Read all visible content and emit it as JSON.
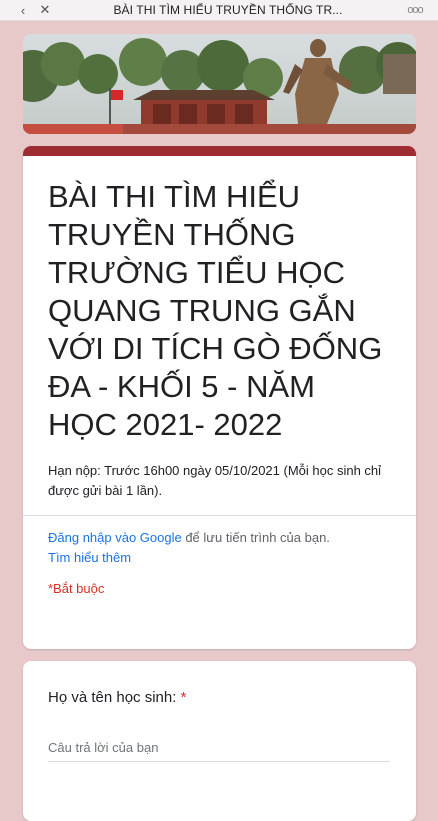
{
  "topbar": {
    "back_icon": "‹",
    "close_icon": "✕",
    "title": "BÀI THI TÌM HIỂU TRUYỀN THỐNG TR...",
    "more_icon": "ooo"
  },
  "form": {
    "title": "BÀI THI TÌM HIỂU TRUYỀN THỐNG TRƯỜNG TIỂU HỌC QUANG TRUNG GẮN VỚI DI TÍCH GÒ ĐỐNG ĐA - KHỐI 5 - NĂM HỌC 2021- 2022",
    "description": "Hạn nộp: Trước 16h00 ngày 05/10/2021 (Mỗi học sinh chỉ được gửi bài 1 lần).",
    "login_link": "Đăng nhập vào Google",
    "login_suffix": " để lưu tiến trình của bạn.",
    "learn_more": "Tìm hiểu thêm",
    "required_note": "*Bắt buộc",
    "accent_color": "#9e2d33"
  },
  "question": {
    "label": "Họ và tên học sinh: ",
    "required_star": "*",
    "placeholder": "Câu trả lời của bạn"
  }
}
